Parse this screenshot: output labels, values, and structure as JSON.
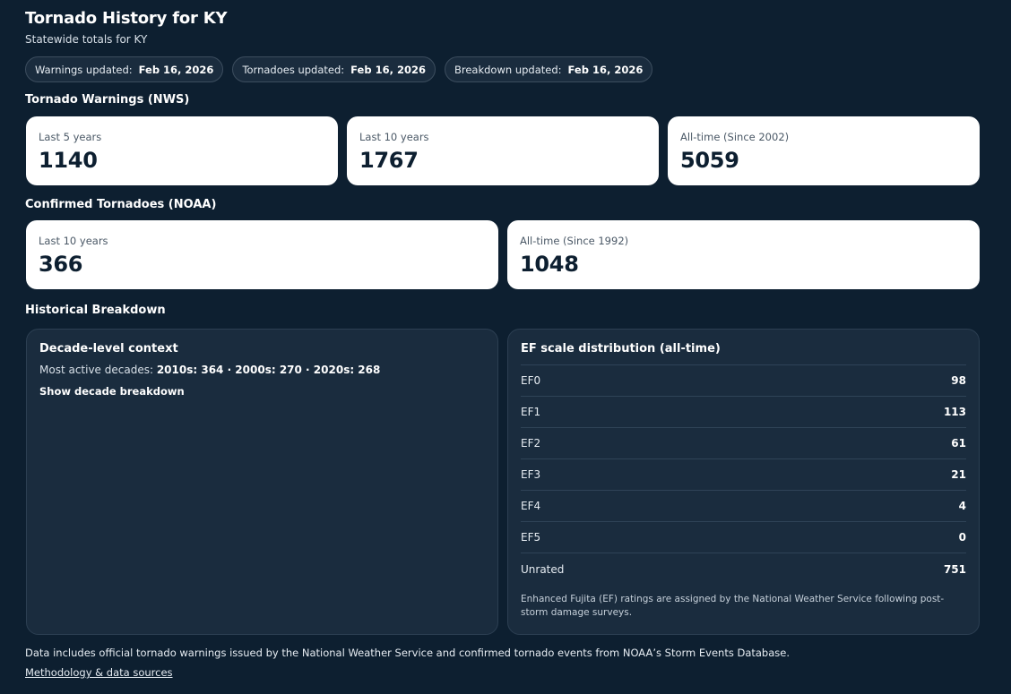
{
  "header": {
    "title": "Tornado History for KY",
    "subtitle": "Statewide totals for KY"
  },
  "updates": [
    {
      "label": "Warnings updated:",
      "date": "Feb 16, 2026"
    },
    {
      "label": "Tornadoes updated:",
      "date": "Feb 16, 2026"
    },
    {
      "label": "Breakdown updated:",
      "date": "Feb 16, 2026"
    }
  ],
  "warnings": {
    "heading": "Tornado Warnings (NWS)",
    "cards": [
      {
        "label": "Last 5 years",
        "value": "1140"
      },
      {
        "label": "Last 10 years",
        "value": "1767"
      },
      {
        "label": "All-time (Since 2002)",
        "value": "5059"
      }
    ]
  },
  "tornadoes": {
    "heading": "Confirmed Tornadoes (NOAA)",
    "cards": [
      {
        "label": "Last 10 years",
        "value": "366"
      },
      {
        "label": "All-time (Since 1992)",
        "value": "1048"
      }
    ]
  },
  "breakdown": {
    "heading": "Historical Breakdown",
    "decade": {
      "title": "Decade-level context",
      "prefix": "Most active decades: ",
      "items": "2010s: 364 · 2000s: 270 · 2020s: 268",
      "toggle": "Show decade breakdown"
    },
    "ef": {
      "title": "EF scale distribution (all-time)",
      "rows": [
        {
          "label": "EF0",
          "value": "98"
        },
        {
          "label": "EF1",
          "value": "113"
        },
        {
          "label": "EF2",
          "value": "61"
        },
        {
          "label": "EF3",
          "value": "21"
        },
        {
          "label": "EF4",
          "value": "4"
        },
        {
          "label": "EF5",
          "value": "0"
        },
        {
          "label": "Unrated",
          "value": "751"
        }
      ],
      "note": "Enhanced Fujita (EF) ratings are assigned by the National Weather Service following post-storm damage surveys."
    }
  },
  "footer": {
    "text": "Data includes official tornado warnings issued by the National Weather Service and confirmed tornado events from NOAA’s Storm Events Database.",
    "link": "Methodology & data sources"
  }
}
